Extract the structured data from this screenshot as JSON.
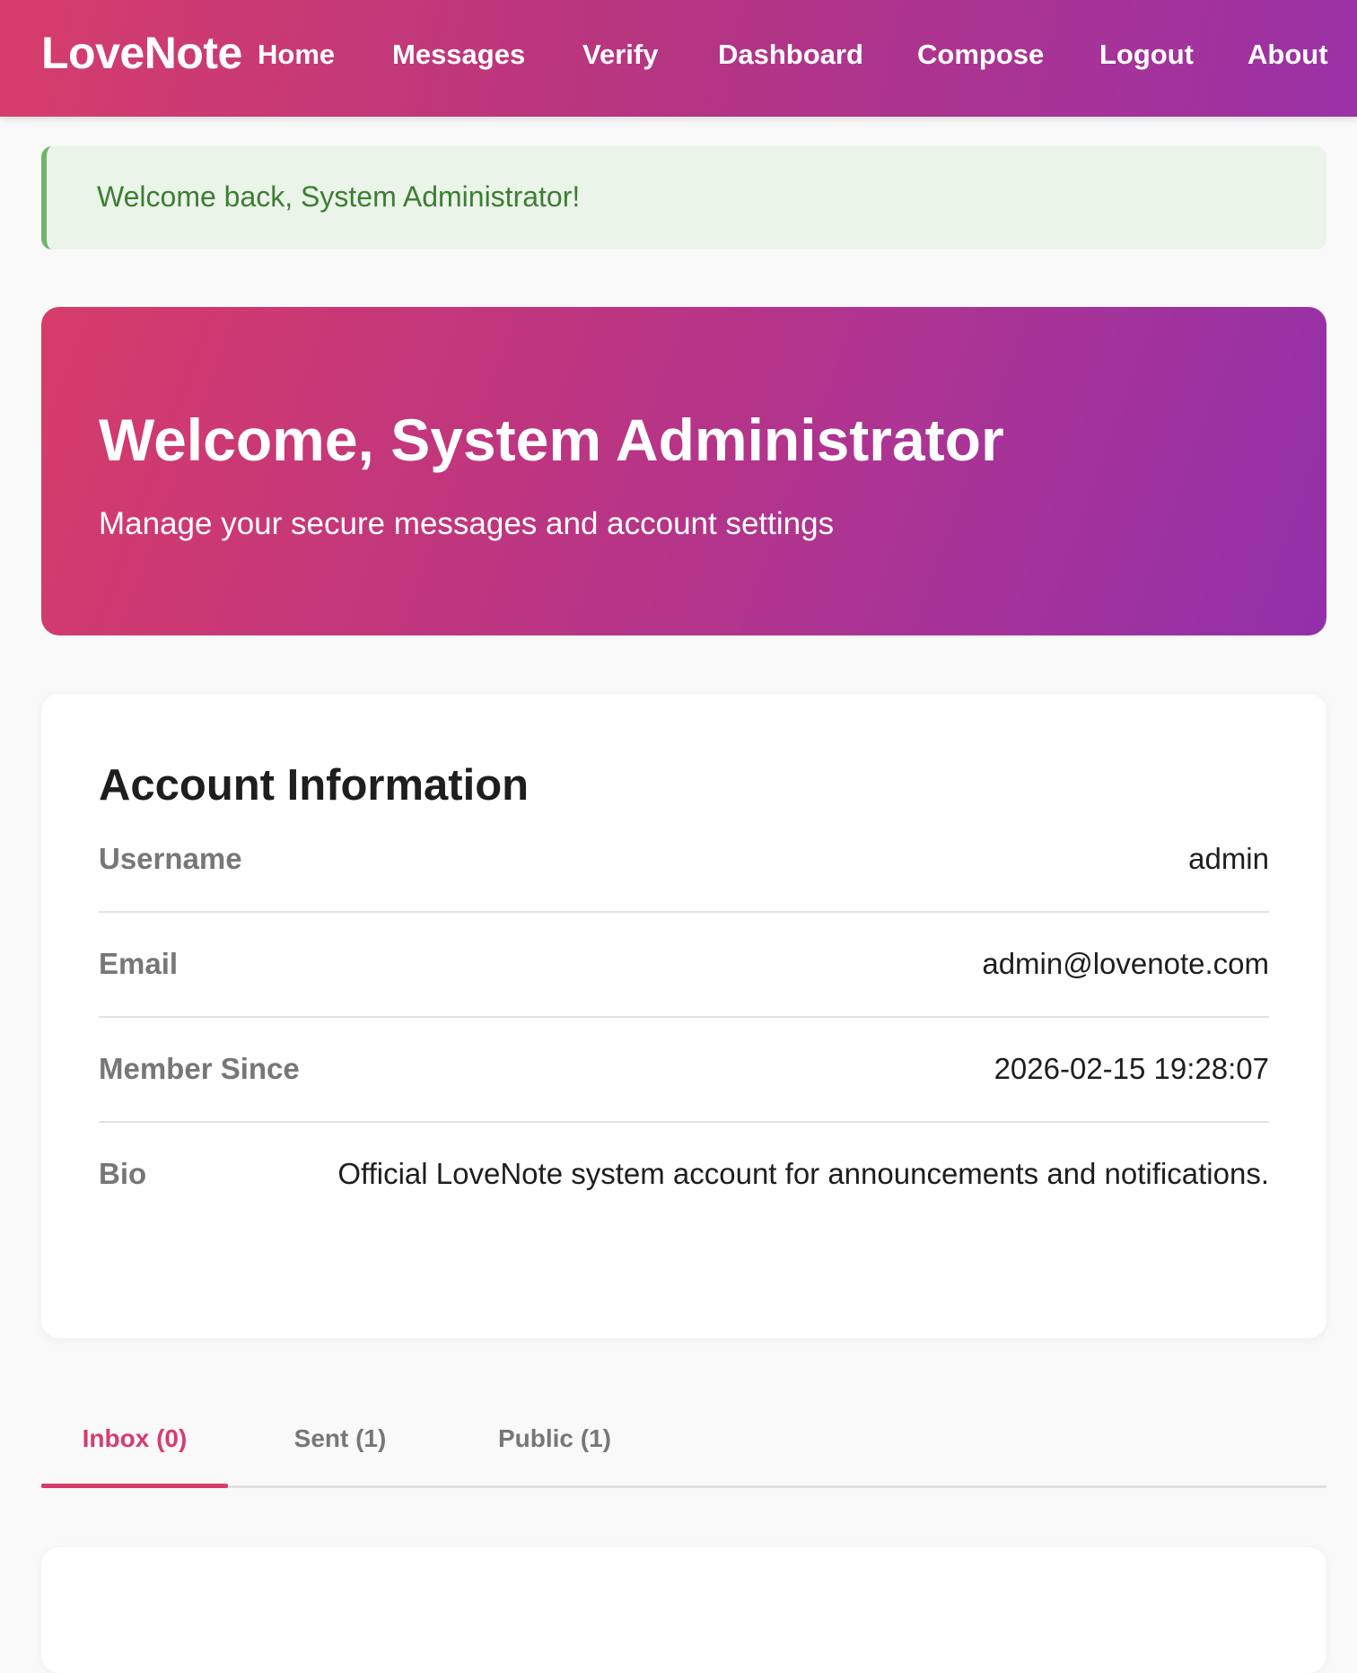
{
  "nav": {
    "brand": "LoveNote",
    "links": [
      "Home",
      "Messages",
      "Verify",
      "Dashboard",
      "Compose",
      "Logout",
      "About"
    ]
  },
  "alert": {
    "message": "Welcome back, System Administrator!"
  },
  "hero": {
    "title": "Welcome, System Administrator",
    "subtitle": "Manage your secure messages and account settings"
  },
  "account": {
    "title": "Account Information",
    "rows": [
      {
        "label": "Username",
        "value": "admin"
      },
      {
        "label": "Email",
        "value": "admin@lovenote.com"
      },
      {
        "label": "Member Since",
        "value": "2026-02-15 19:28:07"
      },
      {
        "label": "Bio",
        "value": "Official LoveNote system account for announcements and notifications."
      }
    ]
  },
  "tabs": [
    {
      "label": "Inbox (0)",
      "active": true
    },
    {
      "label": "Sent (1)",
      "active": false
    },
    {
      "label": "Public (1)",
      "active": false
    }
  ],
  "colors": {
    "brand_pink": "#d63d6b",
    "brand_purple": "#9b32a6",
    "success_text": "#3e7d33",
    "success_bg": "#eaf4e9"
  }
}
